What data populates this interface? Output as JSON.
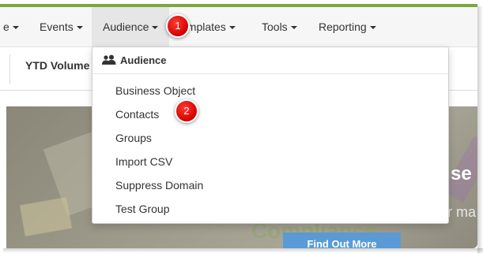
{
  "nav": {
    "items": [
      {
        "label": "e"
      },
      {
        "label": "Events"
      },
      {
        "label": "Audience"
      },
      {
        "label": "emplates"
      },
      {
        "label": "Tools"
      },
      {
        "label": "Reporting"
      }
    ]
  },
  "subbar": {
    "ytd_label": "YTD Volume"
  },
  "dropdown": {
    "header": "Audience",
    "header_icon": "users-icon",
    "items": [
      {
        "label": "Business Object"
      },
      {
        "label": "Contacts"
      },
      {
        "label": "Groups"
      },
      {
        "label": "Import CSV"
      },
      {
        "label": "Suppress Domain"
      },
      {
        "label": "Test Group"
      }
    ]
  },
  "banner": {
    "text_right_1": "se",
    "text_right_2": "r ma",
    "ghost_text": "Compliance",
    "cta_label": "Find Out More"
  },
  "callouts": [
    {
      "number": "1"
    },
    {
      "number": "2"
    }
  ],
  "colors": {
    "accent": "#7aa83c",
    "callout": "#d40000",
    "cta": "#5b9bd5"
  }
}
